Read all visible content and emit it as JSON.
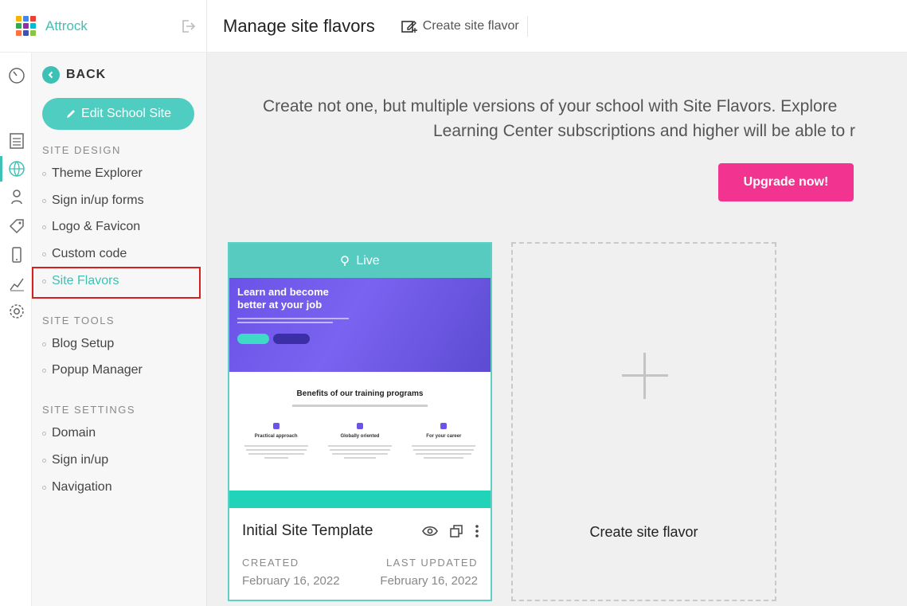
{
  "brand": {
    "name": "Attrock",
    "logo_colors": [
      "#f4b400",
      "#4285f4",
      "#e94235",
      "#34a853",
      "#9c27b0",
      "#00bcd4",
      "#ff7043",
      "#3f51b5",
      "#8bc34a"
    ]
  },
  "header": {
    "title": "Manage site flavors",
    "create_label": "Create site flavor"
  },
  "sidebar": {
    "back_label": "BACK",
    "edit_button": "Edit School Site",
    "sections": [
      {
        "title": "SITE DESIGN",
        "items": [
          "Theme Explorer",
          "Sign in/up forms",
          "Logo & Favicon",
          "Custom code",
          "Site Flavors"
        ]
      },
      {
        "title": "SITE TOOLS",
        "items": [
          "Blog Setup",
          "Popup Manager"
        ]
      },
      {
        "title": "SITE SETTINGS",
        "items": [
          "Domain",
          "Sign in/up",
          "Navigation"
        ]
      }
    ],
    "active_item": "Site Flavors"
  },
  "rail_icons": [
    "dashboard-icon",
    "pages-icon",
    "globe-icon",
    "users-icon",
    "tag-icon",
    "mobile-icon",
    "analytics-icon",
    "settings-icon"
  ],
  "main": {
    "promo_line1": "Create not one, but multiple versions of your school with Site Flavors. Explore",
    "promo_line2": "Learning Center subscriptions and higher will be able to r",
    "upgrade_button": "Upgrade now!",
    "flavor_card": {
      "status": "Live",
      "preview": {
        "hero_title": "Learn and become better at your job",
        "benefits_title": "Benefits of our training programs",
        "benefits": [
          "Practical approach",
          "Globally oriented",
          "For your career"
        ]
      },
      "title": "Initial Site Template",
      "created_label": "CREATED",
      "created_value": "February 16, 2022",
      "updated_label": "LAST UPDATED",
      "updated_value": "February 16, 2022"
    },
    "create_card_label": "Create site flavor"
  },
  "colors": {
    "accent": "#3cc1b4",
    "upgrade": "#f2338f",
    "highlight": "#d62020"
  }
}
